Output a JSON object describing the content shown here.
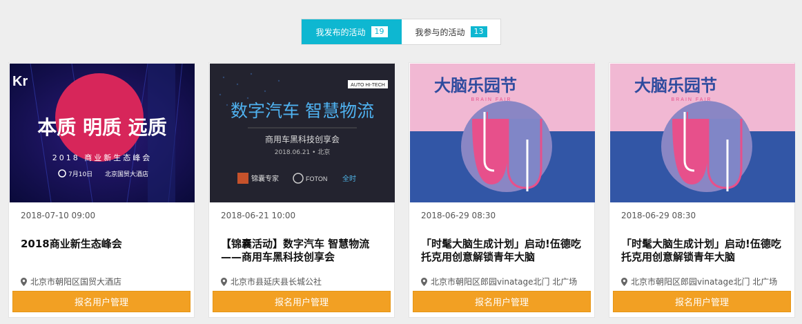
{
  "tabs": [
    {
      "label": "我发布的活动",
      "count": "19",
      "active": true
    },
    {
      "label": "我参与的活动",
      "count": "13",
      "active": false
    }
  ],
  "colors": {
    "accent": "#0eb7d1",
    "button": "#f2a023"
  },
  "cards": [
    {
      "cover": {
        "headline": "本质 明质 远质",
        "sub": "2018 商业新生态峰会",
        "badge": "Kr",
        "info1": "7月10日",
        "info2": "北京国贸大酒店"
      },
      "date": "2018-07-10 09:00",
      "title": "2018商业新生态峰会",
      "location": "北京市朝阳区国贸大酒店",
      "button": "报名用户管理"
    },
    {
      "cover": {
        "headline": "数字汽车 智慧物流",
        "sub": "商用车黑科技创享会",
        "info1": "2018.06.21 • 北京",
        "brand": "AUTO HI-TECH",
        "logo1": "锦囊专家",
        "logo2": "FOTON",
        "logo3": "全时"
      },
      "date": "2018-06-21 10:00",
      "title": "【锦囊活动】数字汽车 智慧物流——商用车黑科技创享会",
      "location": "北京市县延庆县长城公社",
      "button": "报名用户管理"
    },
    {
      "cover": {
        "headline": "大脑乐园节",
        "sub": "BRAIN FAIR"
      },
      "date": "2018-06-29 08:30",
      "title": "「时髦大脑生成计划」启动!伍德吃托克用创意解锁青年大脑",
      "location": "北京市朝阳区郎园vinatage北门 北广场",
      "button": "报名用户管理"
    },
    {
      "cover": {
        "headline": "大脑乐园节",
        "sub": "BRAIN FAIR"
      },
      "date": "2018-06-29 08:30",
      "title": "「时髦大脑生成计划」启动!伍德吃托克用创意解锁青年大脑",
      "location": "北京市朝阳区郎园vinatage北门 北广场",
      "button": "报名用户管理"
    }
  ]
}
